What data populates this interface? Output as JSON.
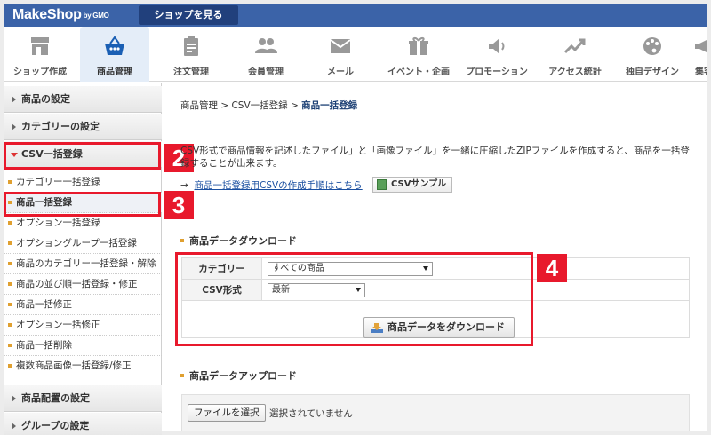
{
  "topbar": {
    "logo": "MakeShop",
    "logo_suffix": "by GMO",
    "shop_button": "ショップを見る"
  },
  "nav": {
    "items": [
      {
        "label": "ショップ作成",
        "icon": "store-icon"
      },
      {
        "label": "商品管理",
        "icon": "basket-icon",
        "active": true
      },
      {
        "label": "注文管理",
        "icon": "clipboard-icon"
      },
      {
        "label": "会員管理",
        "icon": "users-icon"
      },
      {
        "label": "メール",
        "icon": "mail-icon"
      },
      {
        "label": "イベント・企画",
        "icon": "gift-icon"
      },
      {
        "label": "プロモーション",
        "icon": "speaker-icon"
      },
      {
        "label": "アクセス統計",
        "icon": "trend-icon"
      },
      {
        "label": "独自デザイン",
        "icon": "palette-icon"
      },
      {
        "label": "集客",
        "icon": "megaphone-icon"
      }
    ]
  },
  "sidebar": {
    "sections": [
      {
        "label": "商品の設定"
      },
      {
        "label": "カテゴリーの設定"
      },
      {
        "label": "CSV一括登録"
      }
    ],
    "sub_items": [
      "カテゴリー一括登録",
      "商品一括登録",
      "オプション一括登録",
      "オプショングループ一括登録",
      "商品のカテゴリー一括登録・解除",
      "商品の並び順一括登録・修正",
      "商品一括修正",
      "オプション一括修正",
      "商品一括削除",
      "複数商品画像一括登録/修正"
    ],
    "bottom_sections": [
      {
        "label": "商品配置の設定"
      },
      {
        "label": "グループの設定"
      }
    ]
  },
  "badges": {
    "b2": "2",
    "b3": "3",
    "b4": "4"
  },
  "content": {
    "breadcrumb_prefix": "商品管理 > CSV一括登録 > ",
    "breadcrumb_current": "商品一括登録",
    "description": "CSV形式で商品情報を記述したファイル」と「画像ファイル」を一緒に圧縮したZIPファイルを作成すると、商品を一括登録することが出来ます。",
    "doc_arrow": "→",
    "doc_link": "商品一括登録用CSVの作成手順はこちら",
    "csv_sample": "CSVサンプル",
    "download_heading": "商品データダウンロード",
    "category_label": "カテゴリー",
    "category_value": "すべての商品",
    "csv_format_label": "CSV形式",
    "csv_format_value": "最新",
    "download_button": "商品データをダウンロード",
    "upload_heading": "商品データアップロード",
    "file_button": "ファイルを選択",
    "file_status": "選択されていません"
  }
}
